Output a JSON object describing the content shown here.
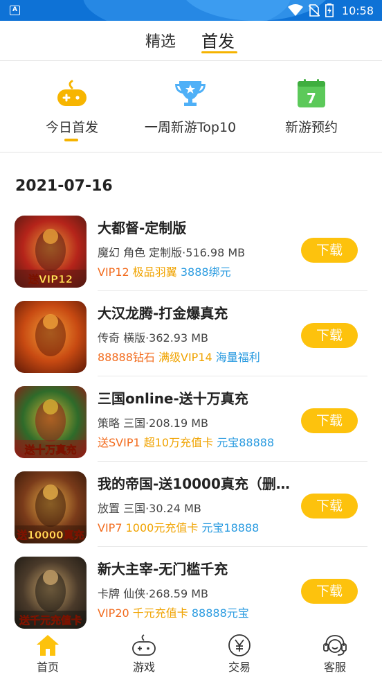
{
  "status_bar": {
    "time": "10:58",
    "app_icon_letter": "A",
    "icons": [
      "wifi-icon",
      "no-sim-icon",
      "battery-icon"
    ]
  },
  "top_tabs": [
    {
      "label": "精选",
      "active": false
    },
    {
      "label": "首发",
      "active": true
    }
  ],
  "categories": [
    {
      "label": "今日首发",
      "icon": "gamepad-icon",
      "active": true
    },
    {
      "label": "一周新游Top10",
      "icon": "trophy-icon",
      "active": false
    },
    {
      "label": "新游预约",
      "icon": "calendar-icon",
      "calendar_day": "7",
      "active": false
    }
  ],
  "date": "2021-07-16",
  "download_label": "下载",
  "games": [
    {
      "name": "大都督-定制版",
      "meta": "魔幻 角色 定制版·516.98 MB",
      "tags": [
        {
          "text": "VIP12",
          "color": "orange"
        },
        {
          "text": "极品羽翼",
          "color": "yellow"
        },
        {
          "text": "3888绑元",
          "color": "blue"
        }
      ],
      "thumb_text": "送VIP12",
      "thumb_colors": [
        "#b5241a",
        "#e8a13a",
        "#5a1a12"
      ]
    },
    {
      "name": "大汉龙腾-打金爆真充",
      "meta": "传奇 横版·362.93 MB",
      "tags": [
        {
          "text": "88888钻石",
          "color": "orange"
        },
        {
          "text": "满级VIP14",
          "color": "yellow"
        },
        {
          "text": "海量福利",
          "color": "blue"
        }
      ],
      "thumb_text": "",
      "thumb_colors": [
        "#c84a12",
        "#f3a23a",
        "#6a1e08"
      ]
    },
    {
      "name": "三国online-送十万真充",
      "meta": "策略 三国·208.19 MB",
      "tags": [
        {
          "text": "送SVIP1",
          "color": "orange"
        },
        {
          "text": "超10万充值卡",
          "color": "yellow"
        },
        {
          "text": "元宝88888",
          "color": "blue"
        }
      ],
      "thumb_text": "送十万真充",
      "thumb_colors": [
        "#2e6b2a",
        "#d8b235",
        "#8a1f16"
      ]
    },
    {
      "name": "我的帝国-送10000真充（删…",
      "meta": "放置 三国·30.24 MB",
      "tags": [
        {
          "text": "VIP7",
          "color": "orange"
        },
        {
          "text": "1000元充值卡",
          "color": "yellow"
        },
        {
          "text": "元宝18888",
          "color": "blue"
        }
      ],
      "thumb_text": "送10000真充",
      "thumb_colors": [
        "#7a3b1a",
        "#e7b048",
        "#3a1a0a"
      ]
    },
    {
      "name": "新大主宰-无门槛千充",
      "meta": "卡牌 仙侠·268.59 MB",
      "tags": [
        {
          "text": "VIP20",
          "color": "orange"
        },
        {
          "text": "千元充值卡",
          "color": "yellow"
        },
        {
          "text": "88888元宝",
          "color": "blue"
        }
      ],
      "thumb_text": "送千元充值卡",
      "thumb_colors": [
        "#4a3a2a",
        "#c9a46a",
        "#1e1a14"
      ]
    }
  ],
  "bottom_nav": [
    {
      "label": "首页",
      "icon": "home-icon",
      "active": true
    },
    {
      "label": "游戏",
      "icon": "gamepad-icon",
      "active": false
    },
    {
      "label": "交易",
      "icon": "yen-icon",
      "active": false
    },
    {
      "label": "客服",
      "icon": "headset-icon",
      "active": false
    }
  ],
  "colors": {
    "accent": "#fdc20d",
    "status_bar": "#0e72d6",
    "tag_orange": "#f26b1d",
    "tag_yellow": "#f0a300",
    "tag_blue": "#2a9be0"
  }
}
